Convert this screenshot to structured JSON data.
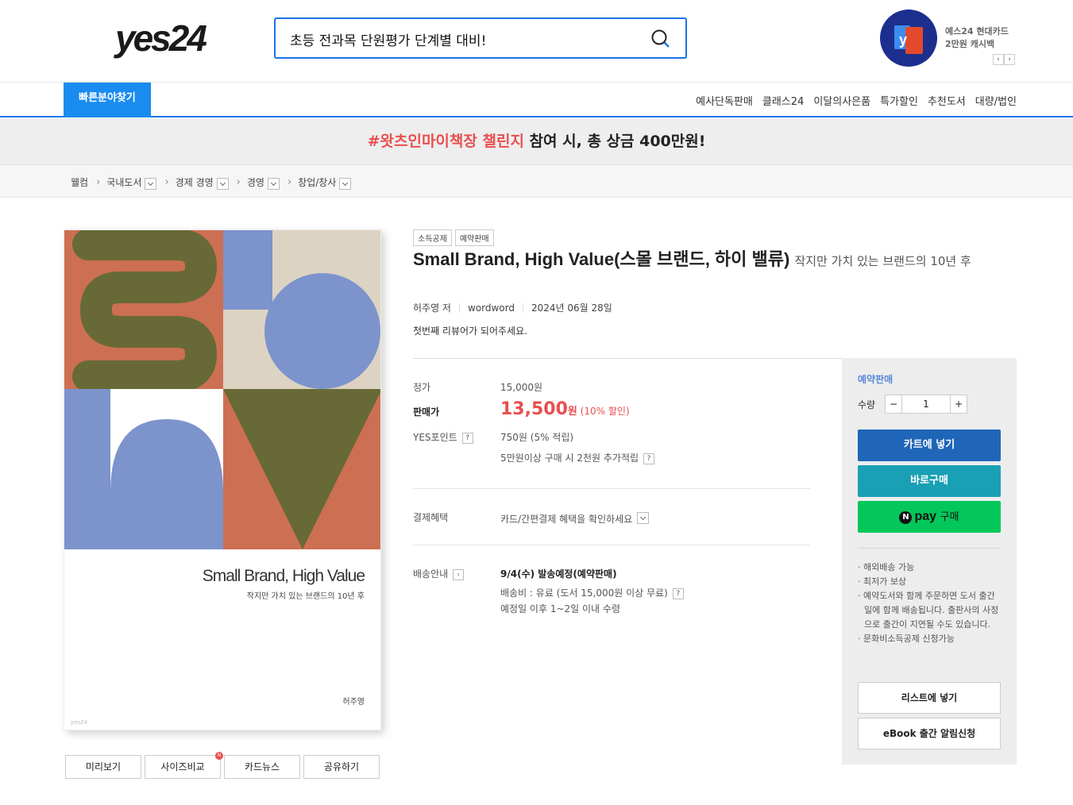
{
  "header": {
    "logo_text": "yes24",
    "search_value": "초등 전과목 단원평가 단계별 대비!",
    "search_icon": "search-icon",
    "promo_line1": "예스24 현대카드",
    "promo_line2": "2만원 캐시백",
    "promo_prev": "‹",
    "promo_next": "›"
  },
  "nav": {
    "quick_label": "빠른분야찾기",
    "links": [
      "예사단독판매",
      "클래스24",
      "이달의사은품",
      "특가할인",
      "추천도서",
      "대량/법인"
    ]
  },
  "banner": {
    "highlight": "#왓츠인마이책장 챌린지",
    "rest": " 참여 시, 총 상금 400만원!"
  },
  "breadcrumb": [
    "웰컴",
    "국내도서",
    "경제 경영",
    "경영",
    "창업/창사"
  ],
  "cover": {
    "title": "Small Brand, High Value",
    "subtitle": "작지만 가치 있는 브랜드의 10년 후",
    "author": "허주영",
    "publisher_mark": "yes24",
    "buttons": [
      "미리보기",
      "사이즈비교",
      "카드뉴스",
      "공유하기"
    ],
    "new_badge": "N"
  },
  "product": {
    "tags": [
      "소득공제",
      "예약판매"
    ],
    "title": "Small Brand, High Value(스몰 브랜드, 하이 밸류)",
    "subtitle": "작지만 가치 있는 브랜드의 10년 후",
    "author": "허주영 저",
    "publisher": "wordword",
    "date": "2024년 06월 28일",
    "review_prompt": "첫번째 리뷰어가 되어주세요.",
    "price_label": "정가",
    "price": "15,000원",
    "sale_label": "판매가",
    "sale_price": "13,500",
    "sale_unit": "원",
    "discount": "(10% 할인)",
    "point_label": "YES포인트",
    "point_value": "750원 (5% 적립)",
    "point_extra": "5만원이상 구매 시 2천원 추가적립",
    "pay_label": "결제혜택",
    "pay_value": "카드/간편결제 혜택을 확인하세요",
    "ship_label": "배송안내",
    "ship_date": "9/4(수) 발송예정(예약판매)",
    "ship_fee": "배송비 : 유료 (도서 15,000원 이상 무료)",
    "ship_note": "예정일 이후 1~2일 이내 수령",
    "qmark": "?"
  },
  "side": {
    "status": "예약판매",
    "qty_label": "수량",
    "qty_minus": "−",
    "qty_value": "1",
    "qty_plus": "+",
    "cart": "카트에 넣기",
    "buy": "바로구매",
    "npay_n": "N",
    "npay_pay": "pay",
    "npay_buy": "구매",
    "notes": [
      "· 해외배송 가능",
      "· 최저가 보상",
      "· 예약도서와 함께 주문하면 도서 출간일에 함께 배송됩니다. 출판사의 사정으로 출간이 지연될 수도 있습니다.",
      "· 문화비소득공제 신청가능"
    ],
    "wishlist": "리스트에 넣기",
    "ebook_alert": "eBook 출간 알림신청"
  }
}
